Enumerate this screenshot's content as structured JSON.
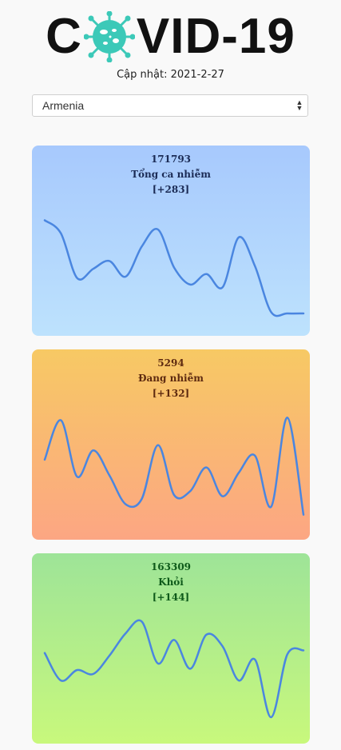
{
  "header": {
    "logo_left": "C",
    "logo_right": "VID-19",
    "logo_icon": "virus-icon",
    "updated": "Cập nhật: 2021-2-27"
  },
  "country_select": {
    "value": "Armenia",
    "arrows_icon": "updown-arrows-icon"
  },
  "cards": [
    {
      "id": "total",
      "count": "171793",
      "label": "Tổng ca nhiễm",
      "delta": "[+283]",
      "color": "#a7c9fd",
      "trend": [
        0.82,
        0.72,
        0.38,
        0.45,
        0.51,
        0.39,
        0.62,
        0.75,
        0.46,
        0.33,
        0.41,
        0.31,
        0.69,
        0.47,
        0.12,
        0.11,
        0.11
      ]
    },
    {
      "id": "active",
      "count": "5294",
      "label": "Đang nhiễm",
      "delta": "[+132]",
      "color": "#f7c964",
      "trend": [
        0.55,
        0.85,
        0.42,
        0.62,
        0.43,
        0.21,
        0.25,
        0.66,
        0.28,
        0.31,
        0.49,
        0.27,
        0.45,
        0.58,
        0.19,
        0.87,
        0.13
      ]
    },
    {
      "id": "recovered",
      "count": "163309",
      "label": "Khỏi",
      "delta": "[+144]",
      "color": "#9ee498",
      "trend": [
        0.63,
        0.42,
        0.5,
        0.47,
        0.61,
        0.78,
        0.87,
        0.55,
        0.73,
        0.51,
        0.77,
        0.68,
        0.42,
        0.58,
        0.14,
        0.62,
        0.65
      ]
    }
  ]
}
